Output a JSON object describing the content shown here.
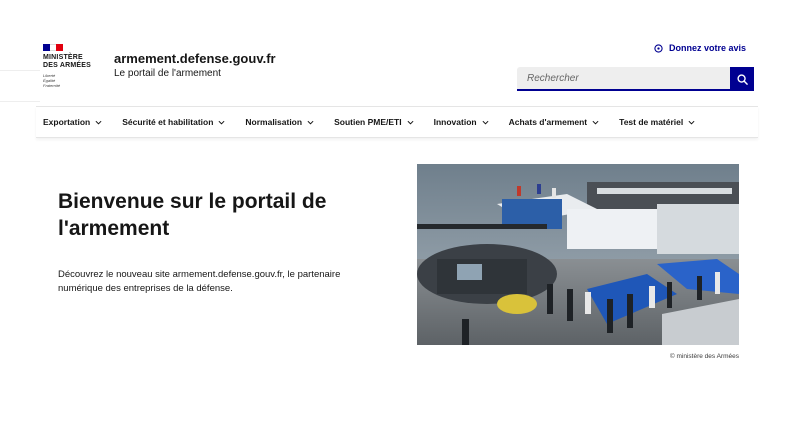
{
  "header": {
    "logo": {
      "title_line1": "MINISTÈRE",
      "title_line2": "DES ARMÉES",
      "motto_line1": "Liberté",
      "motto_line2": "Égalité",
      "motto_line3": "Fraternité"
    },
    "site_name": "armement.defense.gouv.fr",
    "site_tagline": "Le portail de l'armement",
    "feedback_label": "Donnez votre avis",
    "search": {
      "placeholder": "Rechercher"
    }
  },
  "nav": {
    "items": [
      {
        "label": "Exportation"
      },
      {
        "label": "Sécurité et habilitation"
      },
      {
        "label": "Normalisation"
      },
      {
        "label": "Soutien PME/ETI"
      },
      {
        "label": "Innovation"
      },
      {
        "label": "Achats d'armement"
      },
      {
        "label": "Test de matériel"
      }
    ]
  },
  "hero": {
    "title": "Bienvenue sur le portail de l'armement",
    "text": "Découvrez le nouveau site armement.defense.gouv.fr, le partenaire numérique des entreprises de la défense.",
    "image_caption": "© ministère des Armées"
  },
  "colors": {
    "brand_blue": "#000091",
    "brand_red": "#e1000f",
    "text": "#161616"
  }
}
